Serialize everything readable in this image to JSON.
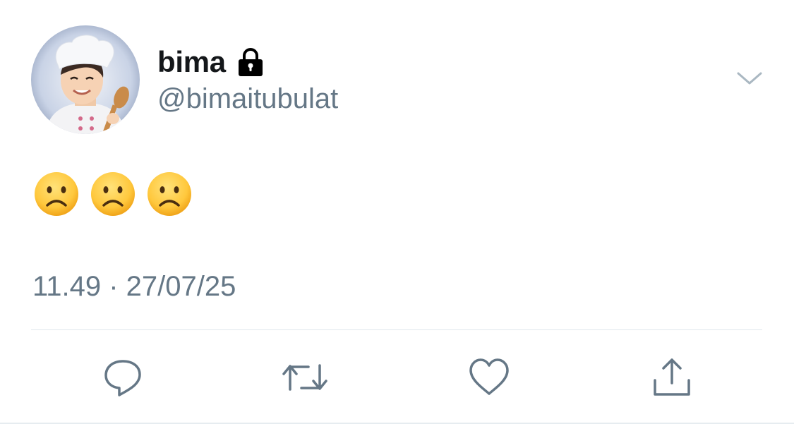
{
  "user": {
    "display_name": "bima",
    "handle": "@bimaitubulat",
    "protected_icon": "lock-icon",
    "avatar": "avatar"
  },
  "menu": {
    "icon": "chevron-down-icon"
  },
  "tweet": {
    "emojis": [
      "☹️",
      "☹️",
      "☹️"
    ],
    "timestamp": "11.49 · 27/07/25"
  },
  "actions": [
    {
      "name": "reply",
      "icon": "reply-icon"
    },
    {
      "name": "retweet",
      "icon": "retweet-icon"
    },
    {
      "name": "like",
      "icon": "heart-icon"
    },
    {
      "name": "share",
      "icon": "share-icon"
    }
  ],
  "colors": {
    "text_primary": "#14171a",
    "text_secondary": "#657786",
    "divider": "#e1e8ed",
    "emoji_face": "#ffc83d"
  }
}
